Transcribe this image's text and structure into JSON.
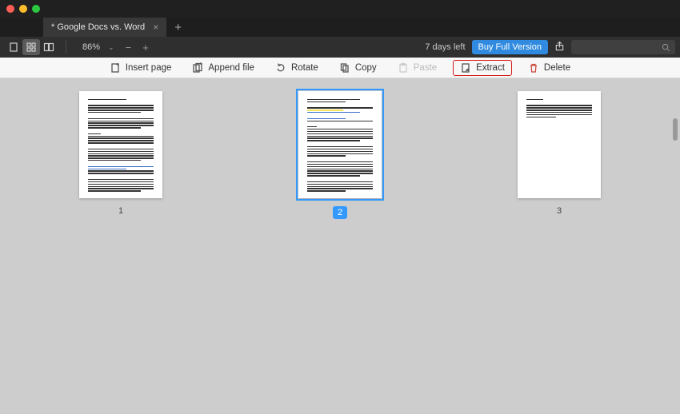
{
  "tab": {
    "title": "* Google Docs vs. Word"
  },
  "toolbar1": {
    "zoom": "86%",
    "days_left": "7 days left",
    "buy": "Buy Full Version"
  },
  "toolbar2": {
    "insert": "Insert page",
    "append": "Append file",
    "rotate": "Rotate",
    "copy": "Copy",
    "paste": "Paste",
    "extract": "Extract",
    "delete": "Delete"
  },
  "pages": {
    "p1": "1",
    "p2": "2",
    "p3": "3",
    "selected": 2
  }
}
